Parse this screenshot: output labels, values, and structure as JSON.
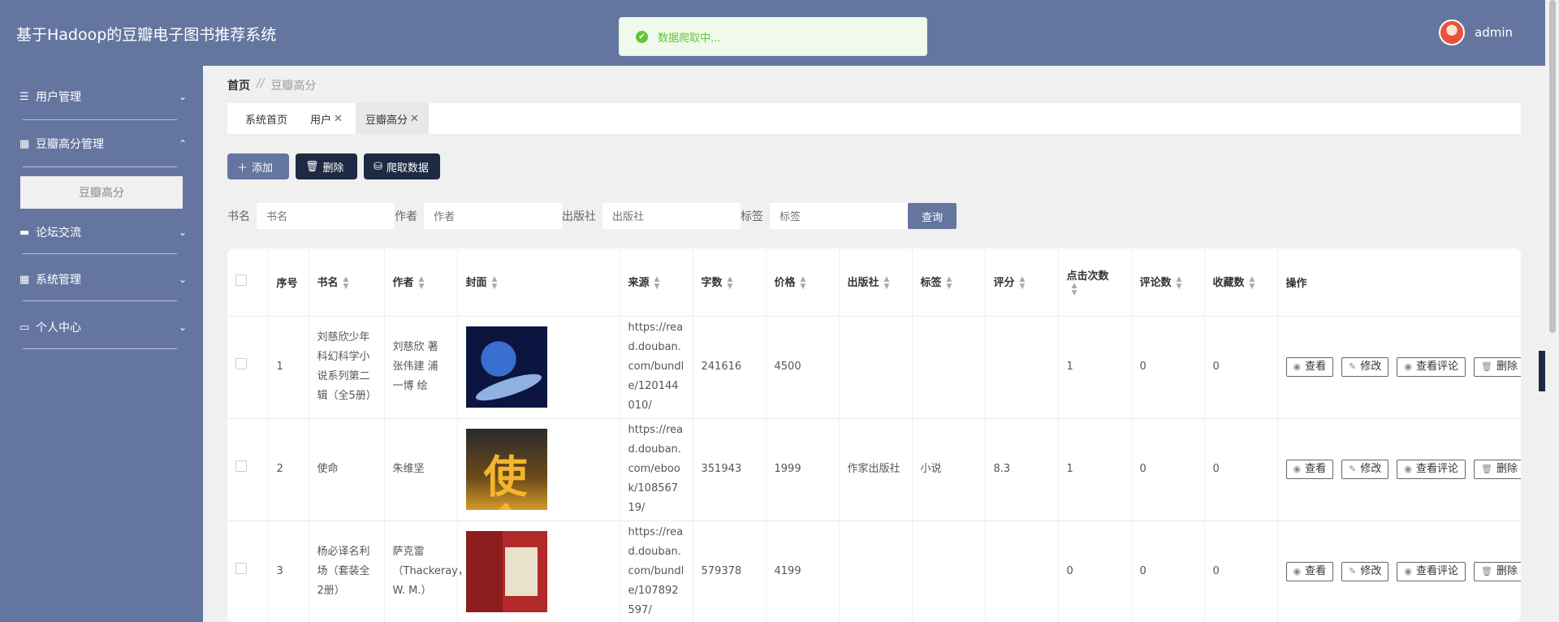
{
  "app": {
    "title": "基于Hadoop的豆瓣电子图书推荐系统",
    "user": "admin"
  },
  "toast": {
    "message": "数据爬取中..."
  },
  "sidebar": {
    "items": [
      {
        "label": "用户管理",
        "icon": "sliders-icon",
        "expanded": false
      },
      {
        "label": "豆瓣高分管理",
        "icon": "grid-icon",
        "expanded": true
      },
      {
        "label": "论坛交流",
        "icon": "briefcase-icon",
        "expanded": false
      },
      {
        "label": "系统管理",
        "icon": "grid-icon",
        "expanded": false
      },
      {
        "label": "个人中心",
        "icon": "id-card-icon",
        "expanded": false
      }
    ],
    "submenu_active": "豆瓣高分"
  },
  "breadcrumb": {
    "home": "首页",
    "sep": "//",
    "current": "豆瓣高分"
  },
  "tabs": [
    {
      "label": "系统首页",
      "closable": false
    },
    {
      "label": "用户",
      "closable": true
    },
    {
      "label": "豆瓣高分",
      "closable": true,
      "active": true
    }
  ],
  "toolbar": {
    "add": "添加",
    "delete": "删除",
    "crawl": "爬取数据"
  },
  "search": {
    "book_label": "书名",
    "book_placeholder": "书名",
    "author_label": "作者",
    "author_placeholder": "作者",
    "publisher_label": "出版社",
    "publisher_placeholder": "出版社",
    "tag_label": "标签",
    "tag_placeholder": "标签",
    "query": "查询"
  },
  "table": {
    "headers": [
      "序号",
      "书名",
      "作者",
      "封面",
      "来源",
      "字数",
      "价格",
      "出版社",
      "标签",
      "评分",
      "点击次数",
      "评论数",
      "收藏数",
      "操作"
    ],
    "rows": [
      {
        "idx": "1",
        "name": "刘慈欣少年科幻科学小说系列第二辑（全5册）",
        "author": "刘慈欣 著 张伟建 浦一博 绘",
        "source": "https://read.douban.com/bundle/120144010/",
        "words": "241616",
        "price": "4500",
        "publisher": "",
        "tag": "",
        "score": "",
        "clicks": "1",
        "comments": "0",
        "favs": "0"
      },
      {
        "idx": "2",
        "name": "使命",
        "author": "朱维坚",
        "source": "https://read.douban.com/ebook/10856719/",
        "words": "351943",
        "price": "1999",
        "publisher": "作家出版社",
        "tag": "小说",
        "score": "8.3",
        "clicks": "1",
        "comments": "0",
        "favs": "0"
      },
      {
        "idx": "3",
        "name": "杨必译名利场（套装全2册）",
        "author": "萨克雷（Thackeray，W. M.）",
        "source": "https://read.douban.com/bundle/107892597/",
        "words": "579378",
        "price": "4199",
        "publisher": "",
        "tag": "",
        "score": "",
        "clicks": "0",
        "comments": "0",
        "favs": "0"
      }
    ],
    "actions": {
      "view": "查看",
      "edit": "修改",
      "view_comments": "查看评论",
      "delete": "删除"
    },
    "cover_text": "使命"
  }
}
